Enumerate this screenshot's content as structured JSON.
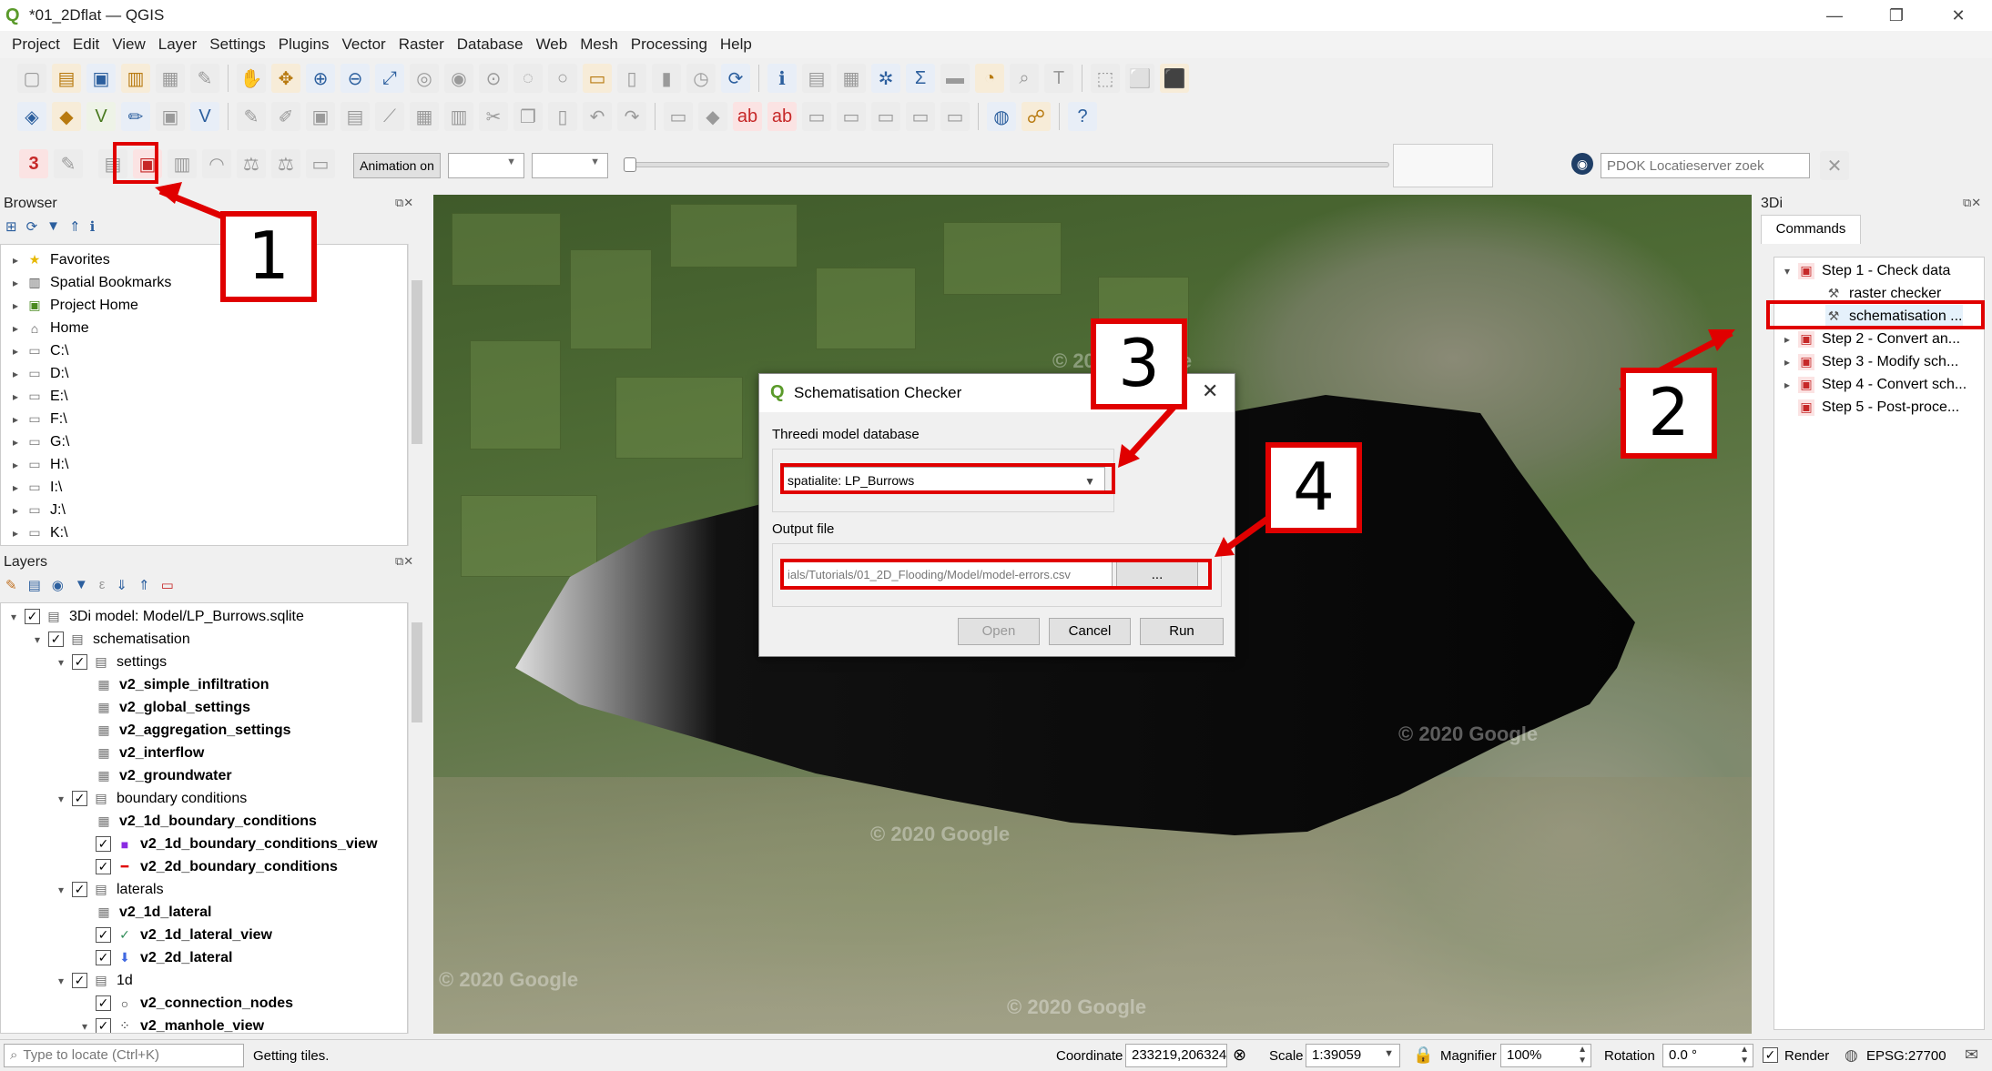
{
  "window": {
    "title": "*01_2Dflat — QGIS",
    "minimize": "—",
    "restore": "❐",
    "close": "✕"
  },
  "menu": [
    "Project",
    "Edit",
    "View",
    "Layer",
    "Settings",
    "Plugins",
    "Vector",
    "Raster",
    "Database",
    "Web",
    "Mesh",
    "Processing",
    "Help"
  ],
  "toolbar3": {
    "animation_button": "Animation on",
    "pdok_placeholder": "PDOK Locatieserver zoek"
  },
  "browser": {
    "title": "Browser",
    "items": [
      "Favorites",
      "Spatial Bookmarks",
      "Project Home",
      "Home",
      "C:\\",
      "D:\\",
      "E:\\",
      "F:\\",
      "G:\\",
      "H:\\",
      "I:\\",
      "J:\\",
      "K:\\"
    ]
  },
  "layers": {
    "title": "Layers",
    "rows": [
      {
        "label": "3Di model: Model/LP_Burrows.sqlite",
        "indent": 0,
        "arrow": true,
        "check": true,
        "icon": "group",
        "bold": false
      },
      {
        "label": "schematisation",
        "indent": 1,
        "arrow": true,
        "check": true,
        "icon": "group",
        "bold": false
      },
      {
        "label": "settings",
        "indent": 2,
        "arrow": true,
        "check": true,
        "icon": "group",
        "bold": false
      },
      {
        "label": "v2_simple_infiltration",
        "indent": 3,
        "arrow": false,
        "check": false,
        "icon": "table",
        "bold": true
      },
      {
        "label": "v2_global_settings",
        "indent": 3,
        "arrow": false,
        "check": false,
        "icon": "table",
        "bold": true
      },
      {
        "label": "v2_aggregation_settings",
        "indent": 3,
        "arrow": false,
        "check": false,
        "icon": "table",
        "bold": true
      },
      {
        "label": "v2_interflow",
        "indent": 3,
        "arrow": false,
        "check": false,
        "icon": "table",
        "bold": true
      },
      {
        "label": "v2_groundwater",
        "indent": 3,
        "arrow": false,
        "check": false,
        "icon": "table",
        "bold": true
      },
      {
        "label": "boundary conditions",
        "indent": 2,
        "arrow": true,
        "check": true,
        "icon": "group",
        "bold": false
      },
      {
        "label": "v2_1d_boundary_conditions",
        "indent": 3,
        "arrow": false,
        "check": false,
        "icon": "table",
        "bold": true
      },
      {
        "label": "v2_1d_boundary_conditions_view",
        "indent": 3,
        "arrow": false,
        "check": true,
        "icon": "square",
        "bold": true
      },
      {
        "label": "v2_2d_boundary_conditions",
        "indent": 3,
        "arrow": false,
        "check": true,
        "icon": "line",
        "bold": true
      },
      {
        "label": "laterals",
        "indent": 2,
        "arrow": true,
        "check": true,
        "icon": "group",
        "bold": false
      },
      {
        "label": "v2_1d_lateral",
        "indent": 3,
        "arrow": false,
        "check": false,
        "icon": "table",
        "bold": true
      },
      {
        "label": "v2_1d_lateral_view",
        "indent": 3,
        "arrow": false,
        "check": true,
        "icon": "tick",
        "bold": true
      },
      {
        "label": "v2_2d_lateral",
        "indent": 3,
        "arrow": false,
        "check": true,
        "icon": "arrowdown",
        "bold": true
      },
      {
        "label": "1d",
        "indent": 2,
        "arrow": true,
        "check": true,
        "icon": "group",
        "bold": false
      },
      {
        "label": "v2_connection_nodes",
        "indent": 3,
        "arrow": false,
        "check": true,
        "icon": "circle",
        "bold": true
      },
      {
        "label": "v2_manhole_view",
        "indent": 3,
        "arrow": true,
        "check": true,
        "icon": "dots",
        "bold": true
      }
    ]
  },
  "threedi_panel": {
    "title": "3Di",
    "tab": "Commands",
    "items": [
      {
        "label": "Step 1 - Check data",
        "level": 0,
        "expanded": true
      },
      {
        "label": "raster checker",
        "level": 1
      },
      {
        "label": "schematisation ...",
        "level": 1
      },
      {
        "label": "Step 2 - Convert an...",
        "level": 0,
        "expanded": false
      },
      {
        "label": "Step 3 - Modify sch...",
        "level": 0,
        "expanded": false
      },
      {
        "label": "Step 4 - Convert sch...",
        "level": 0,
        "expanded": false
      },
      {
        "label": "Step 5 - Post-proce...",
        "level": 0,
        "expanded": false
      }
    ]
  },
  "map": {
    "watermarks": [
      "© 2020 Google",
      "© 2020 Google",
      "© 2020 Google",
      "© 2020 Google",
      "© 2020 Google"
    ]
  },
  "dialog": {
    "title": "Schematisation Checker",
    "db_label": "Threedi model database",
    "db_value": "spatialite: LP_Burrows",
    "output_label": "Output file",
    "output_value": "ials/Tutorials/01_2D_Flooding/Model/model-errors.csv",
    "browse": "...",
    "open": "Open",
    "cancel": "Cancel",
    "run": "Run"
  },
  "annotations": {
    "n1": "1",
    "n2": "2",
    "n3": "3",
    "n4": "4",
    "color": "#e00000"
  },
  "status": {
    "locate_placeholder": "Type to locate (Ctrl+K)",
    "message": "Getting tiles.",
    "coordinate_label": "Coordinate",
    "coordinate_value": "233219,206324",
    "scale_label": "Scale",
    "scale_value": "1:39059",
    "magnifier_label": "Magnifier",
    "magnifier_value": "100%",
    "rotation_label": "Rotation",
    "rotation_value": "0.0 °",
    "render_label": "Render",
    "crs": "EPSG:27700"
  }
}
